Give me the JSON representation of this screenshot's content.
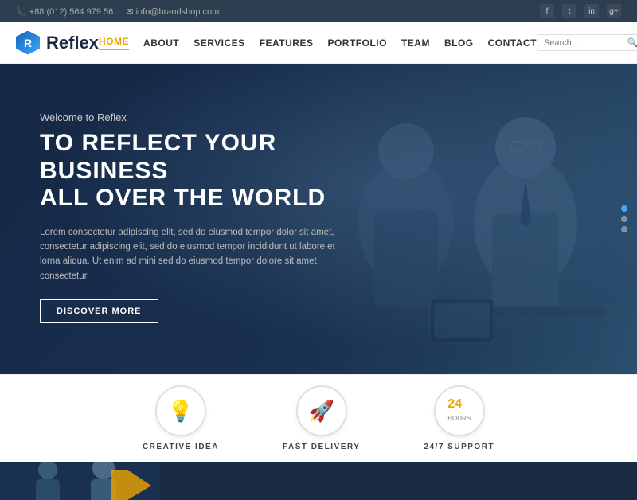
{
  "topbar": {
    "phone": "+88 (012) 564 979 56",
    "email": "info@brandshop.com",
    "phone_icon": "📞",
    "mail_icon": "✉"
  },
  "social": [
    {
      "name": "facebook",
      "icon": "f"
    },
    {
      "name": "twitter",
      "icon": "t"
    },
    {
      "name": "linkedin",
      "icon": "in"
    },
    {
      "name": "googleplus",
      "icon": "g+"
    }
  ],
  "logo": {
    "text": "Reflex",
    "icon_letter": "R"
  },
  "nav": {
    "items": [
      {
        "label": "HOME",
        "active": true
      },
      {
        "label": "ABOUT",
        "active": false
      },
      {
        "label": "SERVICES",
        "active": false
      },
      {
        "label": "FEATURES",
        "active": false
      },
      {
        "label": "PORTFOLIO",
        "active": false
      },
      {
        "label": "TEAM",
        "active": false
      },
      {
        "label": "BLOG",
        "active": false
      },
      {
        "label": "CONTACT",
        "active": false
      }
    ],
    "search_placeholder": "Search..."
  },
  "hero": {
    "subtitle": "Welcome to Reflex",
    "title_line1": "TO REFLECT YOUR BUSINESS",
    "title_line2": "ALL OVER THE WORLD",
    "description": "Lorem consectetur adipiscing elit, sed do eiusmod tempor dolor sit amet, consectetur adipiscing elit, sed do  eiusmod tempor incididunt ut labore et lorna aliqua. Ut enim ad mini sed do eiusmod tempor dolore sit amet, consectetur.",
    "cta_label": "DISCOVER MORE"
  },
  "features": [
    {
      "icon": "💡",
      "label": "CREATIVE IDEA"
    },
    {
      "icon": "🚀",
      "label": "FAST DELIVERY"
    },
    {
      "icon": "24",
      "label": "24/7 SUPPORT",
      "is_text": true
    }
  ],
  "colors": {
    "primary": "#1a2b45",
    "accent": "#f0a500",
    "blue_light": "#42a5f5"
  }
}
